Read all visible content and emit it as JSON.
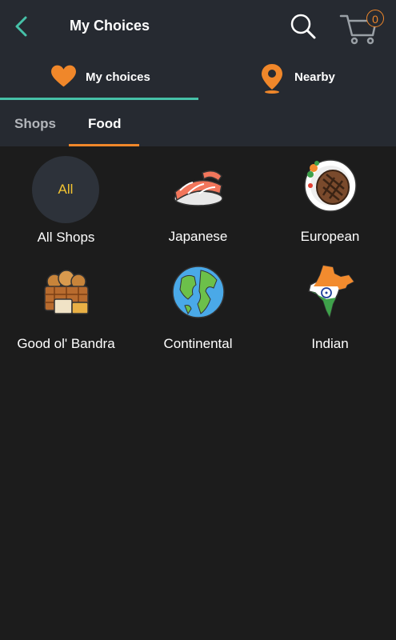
{
  "appbar": {
    "title": "My Choices",
    "cart_count": "0"
  },
  "choice_tabs": [
    {
      "label": "My choices",
      "icon": "heart-icon"
    },
    {
      "label": "Nearby",
      "icon": "location-pin-icon"
    }
  ],
  "sub_tabs": [
    {
      "label": "Shops",
      "selected": false
    },
    {
      "label": "Food",
      "selected": true
    }
  ],
  "categories": [
    {
      "label": "All Shops",
      "badge": "All"
    },
    {
      "label": "Japanese",
      "icon": "sushi-icon"
    },
    {
      "label": "European",
      "icon": "steak-plate-icon"
    },
    {
      "label": "Good ol' Bandra",
      "icon": "bread-basket-icon"
    },
    {
      "label": "Continental",
      "icon": "globe-icon"
    },
    {
      "label": "Indian",
      "icon": "india-map-icon"
    }
  ],
  "colors": {
    "accent_teal": "#46c1a8",
    "accent_orange": "#f0872a",
    "all_text": "#f4c531",
    "bar_bg": "#262a31",
    "page_bg": "#1c1c1c"
  }
}
